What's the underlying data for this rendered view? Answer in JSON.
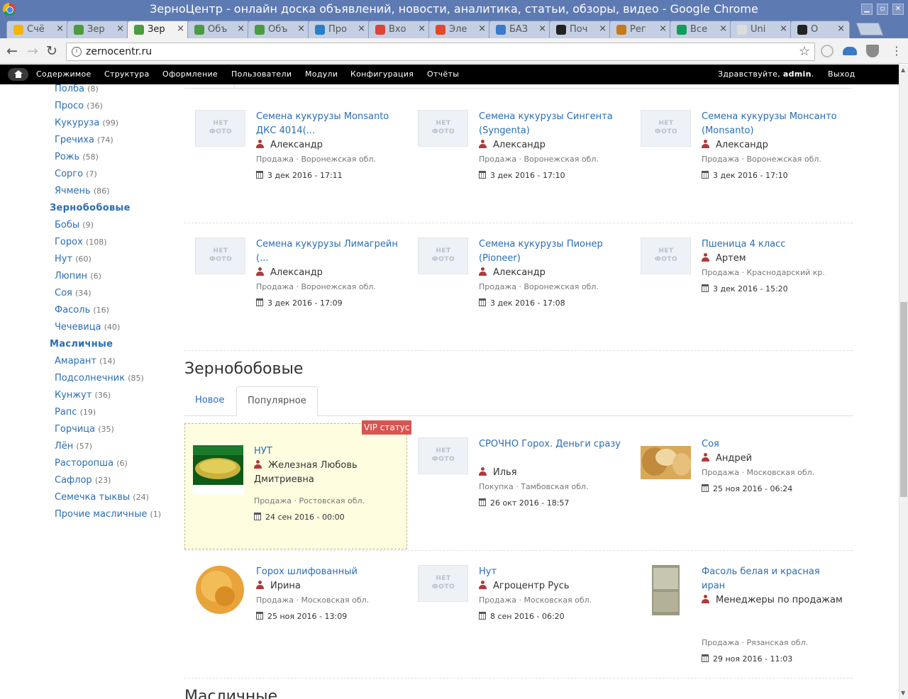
{
  "window": {
    "title": "ЗерноЦентр - онлайн доска объявлений, новости, аналитика, статьи, обзоры, видео - Google Chrome"
  },
  "tabs": [
    {
      "label": "Счё",
      "color": "#f4b400"
    },
    {
      "label": "Зер",
      "color": "#4a9c3f"
    },
    {
      "label": "Зер",
      "color": "#4a9c3f"
    },
    {
      "label": "Объ",
      "color": "#4a9c3f"
    },
    {
      "label": "Объ",
      "color": "#4a9c3f"
    },
    {
      "label": "Про",
      "color": "#2a7fc6"
    },
    {
      "label": "Вхо",
      "color": "#db4437"
    },
    {
      "label": "Эле",
      "color": "#e0492c"
    },
    {
      "label": "БАЗ",
      "color": "#3b79c9"
    },
    {
      "label": "Поч",
      "color": "#222222"
    },
    {
      "label": "Рег",
      "color": "#c67a1a"
    },
    {
      "label": "Все",
      "color": "#0f9d58"
    },
    {
      "label": "Uni",
      "color": "#dddddd"
    },
    {
      "label": "О",
      "color": "#222222"
    }
  ],
  "toolbar": {
    "url": "zernocentr.ru"
  },
  "admin_menu": {
    "items": [
      "Содержимое",
      "Структура",
      "Оформление",
      "Пользователи",
      "Модули",
      "Конфигурация",
      "Отчёты"
    ],
    "greeting": "Здравствуйте,",
    "username": "admin",
    "greeting_end": ".",
    "logout": "Выход"
  },
  "sidebar": {
    "grains": [
      {
        "label": "Полба",
        "count": "(8)"
      },
      {
        "label": "Просо",
        "count": "(36)"
      },
      {
        "label": "Кукуруза",
        "count": "(99)"
      },
      {
        "label": "Гречиха",
        "count": "(74)"
      },
      {
        "label": "Рожь",
        "count": "(58)"
      },
      {
        "label": "Сорго",
        "count": "(7)"
      },
      {
        "label": "Ячмень",
        "count": "(86)"
      }
    ],
    "legumes_title": "Зернобобовые",
    "legumes": [
      {
        "label": "Бобы",
        "count": "(9)"
      },
      {
        "label": "Горох",
        "count": "(108)"
      },
      {
        "label": "Нут",
        "count": "(60)"
      },
      {
        "label": "Люпин",
        "count": "(6)"
      },
      {
        "label": "Соя",
        "count": "(34)"
      },
      {
        "label": "Фасоль",
        "count": "(16)"
      },
      {
        "label": "Чечевица",
        "count": "(40)"
      }
    ],
    "oilseeds_title": "Масличные",
    "oilseeds": [
      {
        "label": "Амарант",
        "count": "(14)"
      },
      {
        "label": "Подсолнечник",
        "count": "(85)"
      },
      {
        "label": "Кунжут",
        "count": "(36)"
      },
      {
        "label": "Рапс",
        "count": "(19)"
      },
      {
        "label": "Горчица",
        "count": "(35)"
      },
      {
        "label": "Лён",
        "count": "(57)"
      },
      {
        "label": "Расторопша",
        "count": "(6)"
      },
      {
        "label": "Сафлор",
        "count": "(23)"
      },
      {
        "label": "Семечка тыквы",
        "count": "(24)"
      },
      {
        "label": "Прочие масличные",
        "count": "(1)"
      }
    ]
  },
  "nophoto_label": "НЕТ ФОТО",
  "grains_items": [
    {
      "title": "Семена кукурузы Monsanto ДКС 4014(...",
      "user": "Александр",
      "meta": "Продажа · Воронежская обл.",
      "date": "3 дек 2016 - 17:11"
    },
    {
      "title": "Семена кукурузы Сингента (Syngenta)",
      "user": "Александр",
      "meta": "Продажа · Воронежская обл.",
      "date": "3 дек 2016 - 17:10"
    },
    {
      "title": "Семена кукурузы Монсанто (Monsanto)",
      "user": "Александр",
      "meta": "Продажа · Воронежская обл.",
      "date": "3 дек 2016 - 17:10"
    },
    {
      "title": "Семена кукурузы Лимагрейн (...",
      "user": "Александр",
      "meta": "Продажа · Воронежская обл.",
      "date": "3 дек 2016 - 17:09"
    },
    {
      "title": "Семена кукурузы Пионер (Pioneer)",
      "user": "Александр",
      "meta": "Продажа · Воронежская обл.",
      "date": "3 дек 2016 - 17:08"
    },
    {
      "title": "Пшеница 4 класс",
      "user": "Артем",
      "meta": "Продажа · Краснодарский кр.",
      "date": "3 дек 2016 - 15:20"
    }
  ],
  "legumes_section": {
    "title": "Зернобобовые",
    "tabs": [
      "Новое",
      "Популярное"
    ],
    "vip_label": "VIP статус",
    "items": [
      {
        "title": "НУТ",
        "user": "Железная Любовь Дмитриевна",
        "meta": "Продажа · Ростовская обл.",
        "date": "24 сен 2016 - 00:00"
      },
      {
        "title": "СРОЧНО Горох. Деньги сразу",
        "user": "Илья",
        "meta": "Покупка · Тамбовская обл.",
        "date": "26 окт 2016 - 18:57"
      },
      {
        "title": "Соя",
        "user": "Андрей",
        "meta": "Продажа · Московская обл.",
        "date": "25 ноя 2016 - 06:24"
      },
      {
        "title": "Горох шлифованный",
        "user": "Ирина",
        "meta": "Продажа · Московская обл.",
        "date": "25 ноя 2016 - 13:09"
      },
      {
        "title": "Нут",
        "user": "Агроцентр Русь",
        "meta": "Продажа · Московская обл.",
        "date": "8 сен 2016 - 06:20"
      },
      {
        "title": "Фасоль белая и красная иран",
        "user": "Менеджеры по продажам",
        "meta": "Продажа · Рязанская обл.",
        "date": "29 ноя 2016 - 11:03"
      }
    ]
  },
  "next_section_title": "Масличные"
}
